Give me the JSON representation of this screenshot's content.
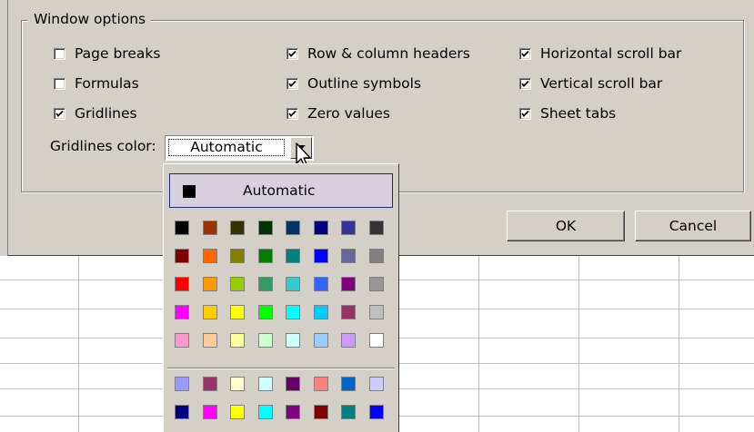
{
  "dialog": {
    "group_title": "Window options",
    "checkboxes": [
      {
        "label": "Page breaks",
        "checked": false
      },
      {
        "label": "Formulas",
        "checked": false
      },
      {
        "label": "Gridlines",
        "checked": true
      },
      {
        "label": "Row & column headers",
        "checked": true
      },
      {
        "label": "Outline symbols",
        "checked": true
      },
      {
        "label": "Zero values",
        "checked": true
      },
      {
        "label": "Horizontal scroll bar",
        "checked": true
      },
      {
        "label": "Vertical scroll bar",
        "checked": true
      },
      {
        "label": "Sheet tabs",
        "checked": true
      }
    ],
    "gridlines_color_label": "Gridlines color:",
    "gridlines_color_value": "Automatic",
    "ok_label": "OK",
    "cancel_label": "Cancel"
  },
  "palette": {
    "automatic_label": "Automatic",
    "automatic_color": "#000000",
    "rows": [
      [
        "#000000",
        "#993300",
        "#333300",
        "#003300",
        "#003366",
        "#000080",
        "#333399",
        "#333333"
      ],
      [
        "#800000",
        "#ff6600",
        "#808000",
        "#008000",
        "#008080",
        "#0000ff",
        "#666699",
        "#808080"
      ],
      [
        "#ff0000",
        "#ff9900",
        "#99cc00",
        "#339966",
        "#33cccc",
        "#3366ff",
        "#800080",
        "#969696"
      ],
      [
        "#ff00ff",
        "#ffcc00",
        "#ffff00",
        "#00ff00",
        "#00ffff",
        "#00ccff",
        "#993366",
        "#c0c0c0"
      ],
      [
        "#ff99cc",
        "#ffcc99",
        "#ffff99",
        "#ccffcc",
        "#ccffff",
        "#99ccff",
        "#cc99ff",
        "#ffffff"
      ]
    ],
    "chart_rows": [
      [
        "#9999ff",
        "#993366",
        "#ffffcc",
        "#ccffff",
        "#660066",
        "#ff8080",
        "#0066cc",
        "#ccccff"
      ],
      [
        "#000080",
        "#ff00ff",
        "#ffff00",
        "#00ffff",
        "#800080",
        "#800000",
        "#008080",
        "#0000ff"
      ]
    ]
  }
}
